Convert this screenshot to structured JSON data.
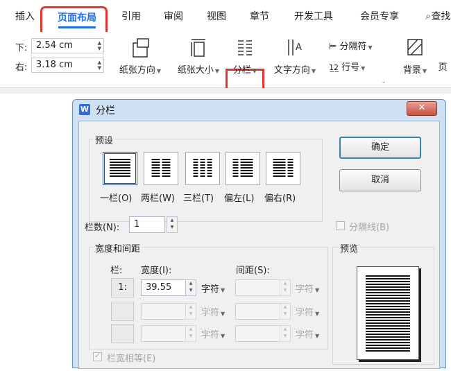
{
  "ribbon": {
    "tabs": [
      "插入",
      "页面布局",
      "引用",
      "审阅",
      "视图",
      "章节",
      "开发工具",
      "会员专享",
      "查找"
    ],
    "active_tab": "页面布局",
    "margins": {
      "bottom_label": "下:",
      "bottom_value": "2.54 cm",
      "right_label": "右:",
      "right_value": "3.18 cm"
    },
    "buttons": {
      "orientation": "纸张方向",
      "size": "纸张大小",
      "columns": "分栏",
      "text_direction": "文字方向",
      "separator": "分隔符",
      "line_number": "行号",
      "background": "背景",
      "page_border": "页"
    }
  },
  "dialog": {
    "title": "分栏",
    "app_icon": "W",
    "close": "✕",
    "presets_title": "预设",
    "presets": [
      "一栏(O)",
      "两栏(W)",
      "三栏(T)",
      "偏左(L)",
      "偏右(R)"
    ],
    "ok": "确定",
    "cancel": "取消",
    "num_cols_label": "栏数(N):",
    "num_cols_value": "1",
    "separator_checkbox": "分隔线(B)",
    "width_spacing_title": "宽度和间距",
    "col_header": "栏:",
    "width_header": "宽度(I):",
    "spacing_header": "间距(S):",
    "row1_index": "1:",
    "row1_width": "39.55",
    "unit": "字符",
    "equal_width": "栏宽相等(E)",
    "preview_title": "预览"
  }
}
